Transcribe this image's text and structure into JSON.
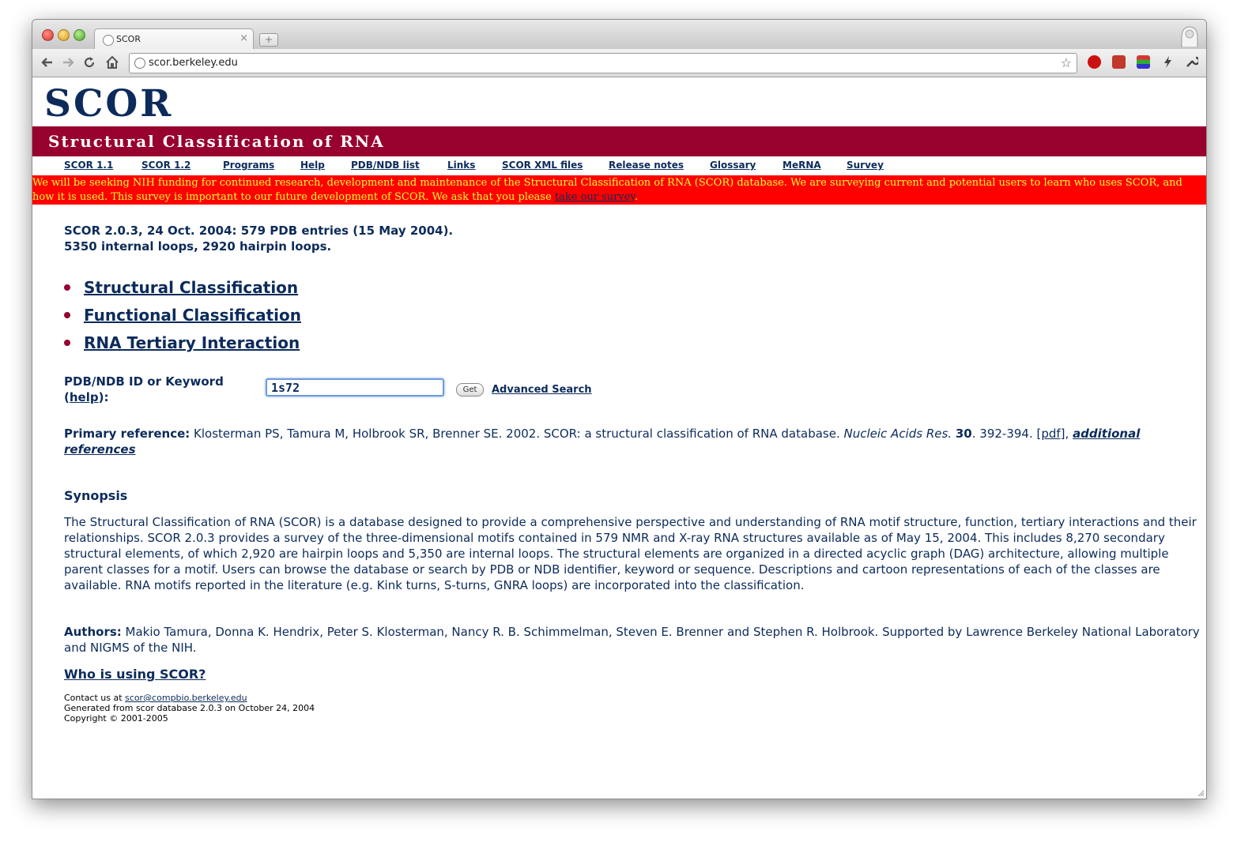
{
  "browser": {
    "tab_title": "SCOR",
    "url": "scor.berkeley.edu",
    "newtab_label": "+",
    "close_glyph": "×",
    "icons": [
      "back-icon",
      "forward-icon",
      "reload-icon",
      "home-icon",
      "star-icon",
      "adblock-icon",
      "dictionary-icon",
      "color-icon",
      "flash-icon",
      "wrench-icon"
    ]
  },
  "site": {
    "logo": "SCOR",
    "banner": "Structural Classification of RNA",
    "nav": [
      "SCOR 1.1",
      "SCOR 1.2 ",
      "Programs",
      "Help",
      "PDB/NDB list",
      "Links",
      "SCOR XML files",
      "Release notes",
      "Glossary",
      "MeRNA",
      "Survey"
    ],
    "alert_text": "We will be seeking NIH funding for continued research, development and maintenance of the Structural Classification of RNA (SCOR) database. We are surveying current and potential users to learn who uses SCOR, and how it is used. This survey is important to our future development of SCOR. We ask that you please ",
    "alert_link": "take our survey",
    "alert_end": ".",
    "accent_colors": {
      "banner": "#98002e",
      "alert": "#ff0000",
      "text": "#0c2b5b",
      "alert_text": "#ffff33"
    }
  },
  "content": {
    "stats_line1": "SCOR 2.0.3, 24 Oct. 2004: 579 PDB entries (15 May 2004).",
    "stats_line2": "5350 internal loops, 2920 hairpin loops.",
    "classifications": [
      "Structural Classification",
      "Functional Classification",
      "RNA Tertiary Interaction"
    ],
    "search": {
      "label_line1": "PDB/NDB ID or Keyword",
      "label_open": "(",
      "help": "help",
      "label_close": "):",
      "value": "1s72",
      "get": "Get",
      "advanced": "Advanced Search"
    },
    "reference": {
      "label": "Primary reference:",
      "authors": " Klosterman PS, Tamura M, Holbrook SR, Brenner SE. 2002. SCOR: a structural classification of RNA database.  ",
      "journal": "Nucleic Acids Res.",
      "volume": "30",
      "pages": ". 392-394. ",
      "pdf": "[pdf]",
      "sep": ",   ",
      "additional": "additional references"
    },
    "synopsis_heading": "Synopsis",
    "synopsis": "The Structural Classification of RNA (SCOR) is a database designed to provide a comprehensive perspective and understanding of RNA motif structure, function, tertiary interactions and their relationships. SCOR 2.0.3 provides a survey of the three-dimensional motifs contained in 579 NMR and X-ray RNA structures available as of May 15, 2004. This includes 8,270 secondary structural elements, of which 2,920 are hairpin loops and 5,350 are internal loops. The structural elements are organized in a directed acyclic graph (DAG) architecture, allowing multiple parent classes for a motif. Users can browse the database or search by PDB or NDB identifier, keyword or sequence. Descriptions and cartoon representations of each of the classes are available. RNA motifs reported in the literature (e.g. Kink turns, S-turns, GNRA loops) are incorporated into the classification.",
    "authors_label": "Authors:",
    "authors": " Makio Tamura, Donna K. Hendrix, Peter S. Klosterman, Nancy R. B. Schimmelman, Steven E. Brenner and Stephen R. Holbrook.   Supported by Lawrence Berkeley National Laboratory and NIGMS of the NIH.",
    "who": "Who is using SCOR?",
    "footer": {
      "contact_prefix": "Contact us at ",
      "email": "scor@compbio.berkeley.edu",
      "generated": "Generated from scor database 2.0.3 on October 24, 2004",
      "copyright": "Copyright © 2001-2005"
    }
  }
}
